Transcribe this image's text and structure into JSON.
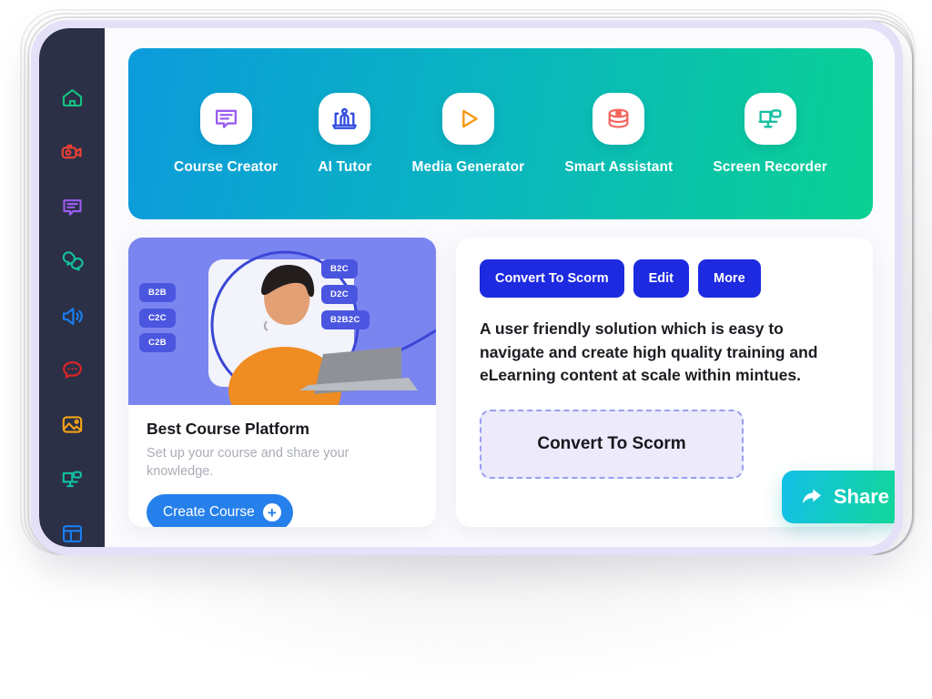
{
  "window": {
    "accent_lavender": "#e4e0f7",
    "sidebar_bg": "#2b3047"
  },
  "sidebar": {
    "items": [
      {
        "icon": "home-icon",
        "color": "#14c37d"
      },
      {
        "icon": "video-camera-icon",
        "color": "#ef3f34"
      },
      {
        "icon": "message-lines-icon",
        "color": "#9a5cf0"
      },
      {
        "icon": "chat-bubbles-icon",
        "color": "#12c19a"
      },
      {
        "icon": "speaker-volume-icon",
        "color": "#1a7ef0"
      },
      {
        "icon": "comment-dots-icon",
        "color": "#e02424"
      },
      {
        "icon": "image-photo-icon",
        "color": "#f5a314"
      },
      {
        "icon": "screen-record-icon",
        "color": "#12bfa0"
      },
      {
        "icon": "layout-grid-icon",
        "color": "#1a7ef0"
      }
    ]
  },
  "banner": {
    "gradient_from": "#0c9bdc",
    "gradient_to": "#0ad193",
    "features": [
      {
        "label": "Course Creator",
        "icon": "message-lines-icon",
        "color": "#9a5cf0"
      },
      {
        "label": "AI Tutor",
        "icon": "laptop-person-icon",
        "color": "#2f4ae0"
      },
      {
        "label": "Media Generator",
        "icon": "play-triangle-icon",
        "color": "#f79a16"
      },
      {
        "label": "Smart Assistant",
        "icon": "database-stack-icon",
        "color": "#f4645f"
      },
      {
        "label": "Screen Recorder",
        "icon": "screen-record-icon",
        "color": "#12bfa0"
      }
    ]
  },
  "left_card": {
    "hero": {
      "bg_color": "#7b85ef",
      "tag_color": "#4b56e0",
      "tags_left": [
        "B2B",
        "C2C",
        "C2B"
      ],
      "tags_right": [
        "B2C",
        "D2C",
        "B2B2C"
      ]
    },
    "title": "Best Course Platform",
    "subtitle": "Set up your course and share your knowledge.",
    "button_label": "Create Course",
    "button_icon": "plus-icon",
    "button_color": "#2680eb"
  },
  "right_card": {
    "buttons": [
      {
        "label": "Convert To Scorm"
      },
      {
        "label": "Edit"
      },
      {
        "label": "More"
      }
    ],
    "button_color": "#1d2ae0",
    "description": "A user friendly solution which is easy to navigate and create high quality training and eLearning content at scale  within mintues.",
    "dropzone_label": "Convert To Scorm",
    "dropzone_border_color": "#9a9ef0",
    "dropzone_bg_color": "#eceafb"
  },
  "share_button": {
    "label": "Share",
    "icon": "share-arrow-icon",
    "gradient_from": "#13c0e8",
    "gradient_to": "#12d98e"
  }
}
